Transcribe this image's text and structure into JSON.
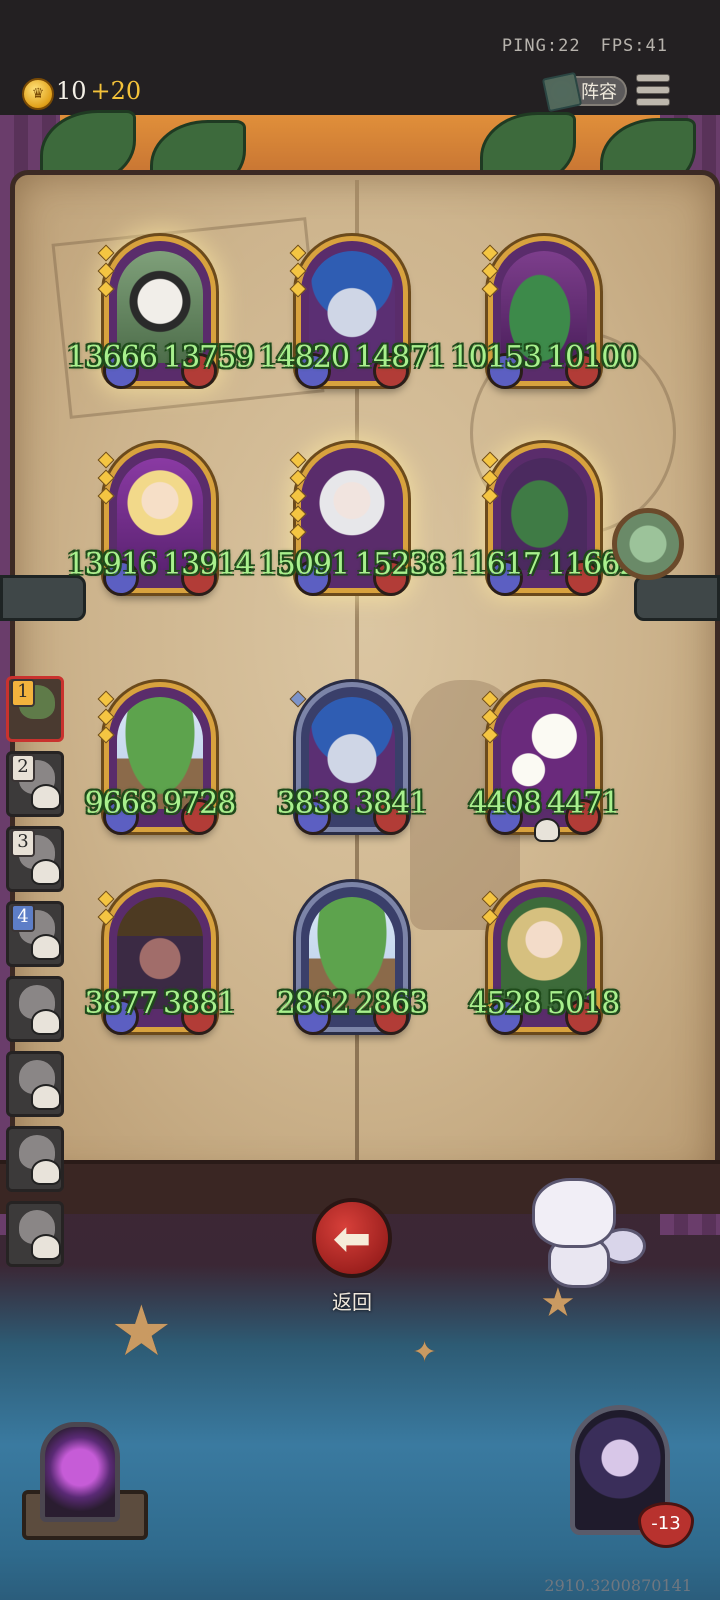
{
  "status": {
    "ping": "PING:22",
    "fps": "FPS:41"
  },
  "currency": {
    "gold": "10",
    "income": "+20",
    "coin_icon": "crown-coin-icon"
  },
  "header_buttons": {
    "lineup_label": "阵容",
    "menu_icon": "hamburger-menu-icon"
  },
  "team_slots": [
    {
      "number": "1",
      "state": "selected"
    },
    {
      "number": "2",
      "state": "defeated"
    },
    {
      "number": "3",
      "state": "defeated"
    },
    {
      "number": "4",
      "state": "defeated"
    },
    {
      "number": "",
      "state": "defeated"
    },
    {
      "number": "",
      "state": "defeated"
    },
    {
      "number": "",
      "state": "defeated"
    },
    {
      "number": "",
      "state": "defeated"
    }
  ],
  "cards": [
    {
      "id": "dog-miner",
      "frame": "gold",
      "stars": 3,
      "hp_left": "13666",
      "hp_right": "13759"
    },
    {
      "id": "blue-elf",
      "frame": "gold",
      "stars": 3,
      "hp_left": "14820",
      "hp_right": "14871"
    },
    {
      "id": "crocodile",
      "frame": "gold",
      "stars": 3,
      "hp_left": "10153",
      "hp_right": "10100"
    },
    {
      "id": "blonde-sorceress",
      "frame": "gold",
      "stars": 3,
      "hp_left": "13916",
      "hp_right": "13914"
    },
    {
      "id": "white-haired",
      "frame": "gold",
      "stars": 5,
      "hp_left": "15091",
      "hp_right": "15238"
    },
    {
      "id": "parrot",
      "frame": "gold",
      "stars": 3,
      "hp_left": "11617",
      "hp_right": "11662"
    },
    {
      "id": "tree",
      "frame": "gold",
      "stars": 3,
      "hp_left": "9668",
      "hp_right": "9728"
    },
    {
      "id": "blue-elf-2",
      "frame": "silver",
      "stars": 1,
      "hp_left": "3838",
      "hp_right": "3841"
    },
    {
      "id": "flower",
      "frame": "gold",
      "stars": 3,
      "hp_left": "4408",
      "hp_right": "4471"
    },
    {
      "id": "witch",
      "frame": "gold",
      "stars": 2,
      "hp_left": "3877",
      "hp_right": "3881"
    },
    {
      "id": "tree-2",
      "frame": "silver",
      "stars": 0,
      "hp_left": "2862",
      "hp_right": "2863"
    },
    {
      "id": "dryad",
      "frame": "gold",
      "stars": 2,
      "hp_left": "4528",
      "hp_right": "5018"
    }
  ],
  "back_button": {
    "label": "返回",
    "icon": "arrow-left-icon"
  },
  "player": {
    "badge": "-13"
  },
  "version": "2910.3200870141",
  "colors": {
    "hp_text": "#a8f08d",
    "accent_gold": "#d8a23e",
    "back_red": "#c9322e"
  }
}
